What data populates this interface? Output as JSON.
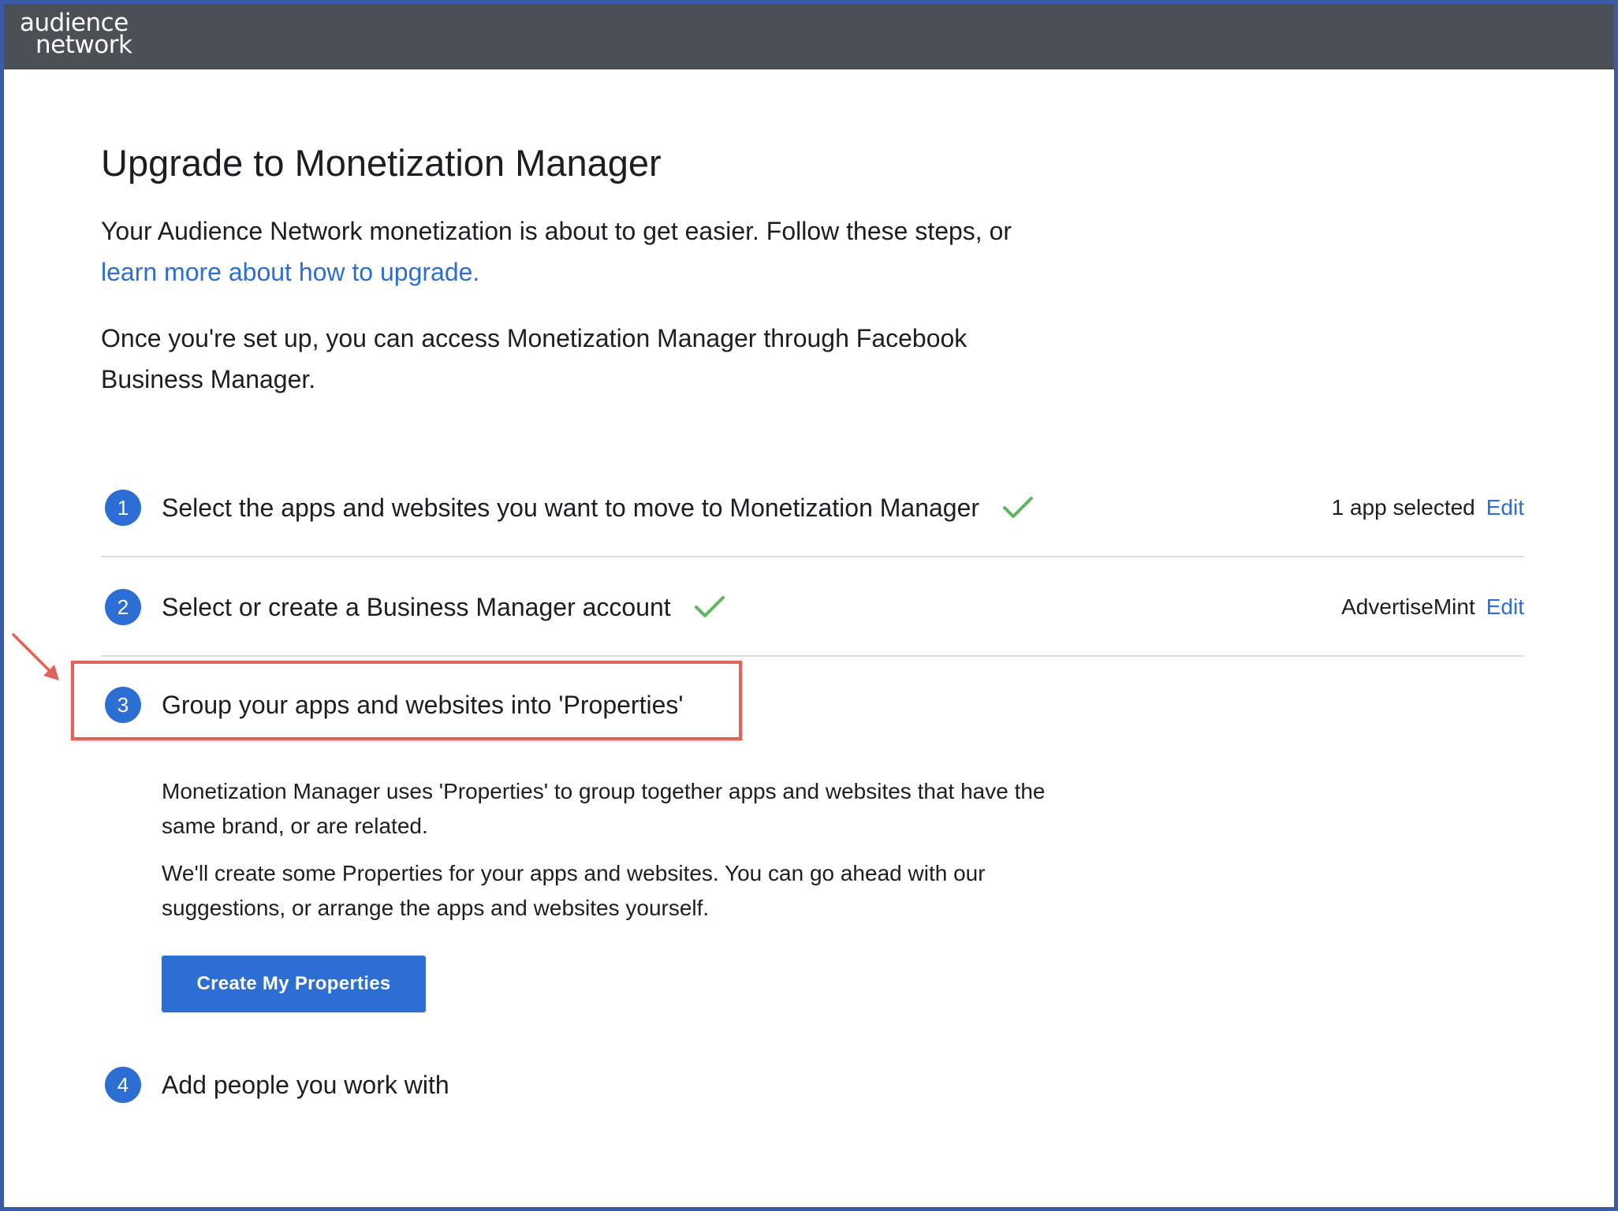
{
  "header": {
    "logo_line1": "audience",
    "logo_line2": "network"
  },
  "main": {
    "title": "Upgrade to Monetization Manager",
    "intro_text": "Your Audience Network monetization is about to get easier. Follow these steps, or ",
    "intro_link": "learn more about how to upgrade.",
    "setup_text": "Once you're set up, you can access Monetization Manager through Facebook Business Manager."
  },
  "steps": [
    {
      "number": "1",
      "label": "Select the apps and websites you want to move to Monetization Manager",
      "completed": true,
      "status": "1 app selected",
      "edit_label": "Edit"
    },
    {
      "number": "2",
      "label": "Select or create a Business Manager account",
      "completed": true,
      "status": "AdvertiseMint",
      "edit_label": "Edit"
    },
    {
      "number": "3",
      "label": "Group your apps and websites into 'Properties'",
      "completed": false,
      "description_1": "Monetization Manager uses 'Properties' to group together apps and websites that have the same brand, or are related.",
      "description_2": "We'll create some Properties for your apps and websites. You can go ahead with our suggestions, or arrange the apps and websites yourself.",
      "button_label": "Create My Properties"
    },
    {
      "number": "4",
      "label": "Add people you work with",
      "completed": false
    }
  ],
  "colors": {
    "accent": "#2c6ed3",
    "check": "#5cb85c",
    "highlight": "#e0645a",
    "header_bg": "#4b4f56"
  },
  "icons": {
    "check": "checkmark-icon",
    "annotation": "arrow-icon"
  }
}
